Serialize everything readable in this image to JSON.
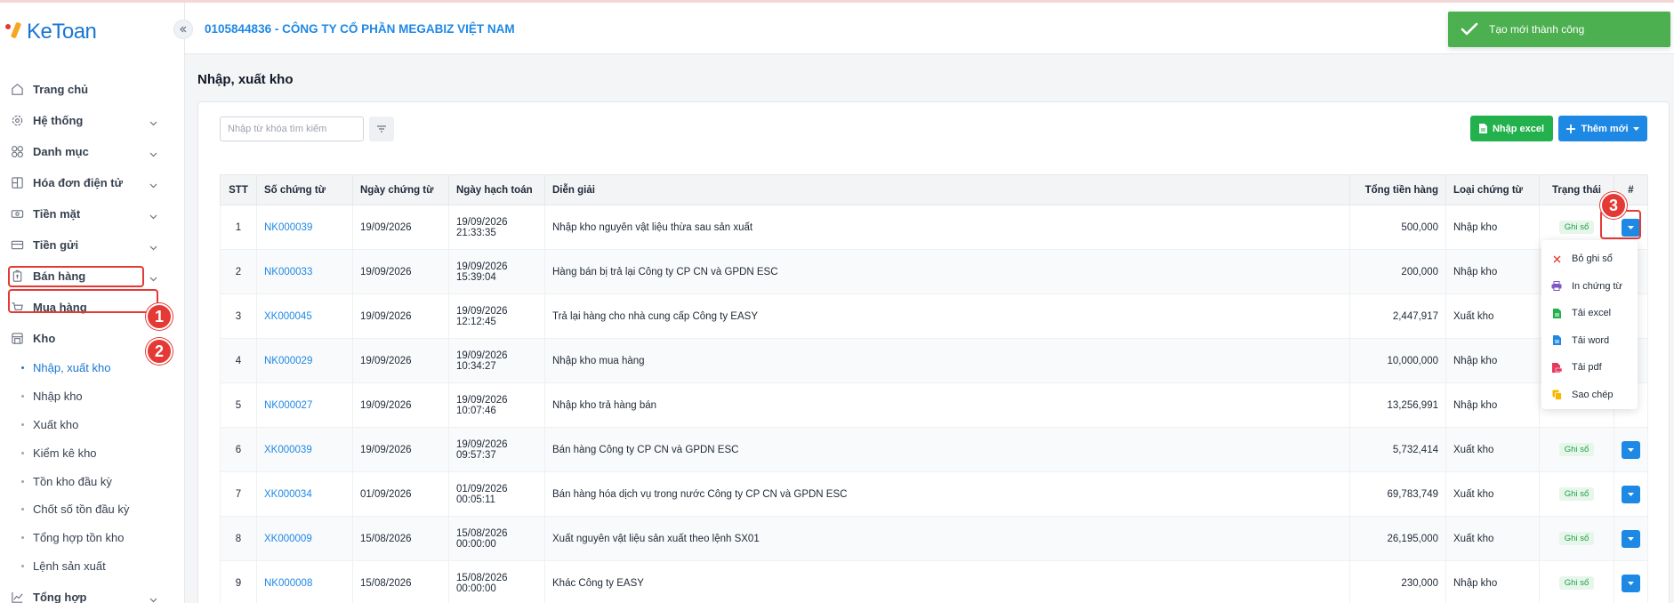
{
  "app": {
    "logo_text": "KeToan"
  },
  "header": {
    "company": "0105844836 - CÔNG TY CỔ PHẦN MEGABIZ VIỆT NAM"
  },
  "toast": {
    "message": "Tạo mới thành công"
  },
  "sidebar": {
    "items": [
      {
        "label": "Trang chủ",
        "icon": "home-icon",
        "chevron": false
      },
      {
        "label": "Hệ thống",
        "icon": "gear-icon",
        "chevron": true
      },
      {
        "label": "Danh mục",
        "icon": "grid-icon",
        "chevron": true
      },
      {
        "label": "Hóa đơn điện tử",
        "icon": "invoice-icon",
        "chevron": true
      },
      {
        "label": "Tiền mặt",
        "icon": "cash-icon",
        "chevron": true
      },
      {
        "label": "Tiền gửi",
        "icon": "bank-card-icon",
        "chevron": true
      },
      {
        "label": "Bán hàng",
        "icon": "sales-icon",
        "chevron": true
      },
      {
        "label": "Mua hàng",
        "icon": "cart-icon",
        "chevron": false
      },
      {
        "label": "Kho",
        "icon": "warehouse-icon",
        "chevron": false
      }
    ],
    "sub_items": [
      {
        "label": "Nhập, xuất kho",
        "active": true
      },
      {
        "label": "Nhập kho",
        "active": false
      },
      {
        "label": "Xuất kho",
        "active": false
      },
      {
        "label": "Kiểm kê kho",
        "active": false
      },
      {
        "label": "Tồn kho đầu kỳ",
        "active": false
      },
      {
        "label": "Chốt số tồn đầu kỳ",
        "active": false
      },
      {
        "label": "Tổng hợp tồn kho",
        "active": false
      },
      {
        "label": "Lệnh sản xuất",
        "active": false
      }
    ],
    "bottom_item": {
      "label": "Tổng hợp",
      "icon": "chart-line-icon"
    }
  },
  "callouts": [
    "1",
    "2",
    "3"
  ],
  "page": {
    "title": "Nhập, xuất kho"
  },
  "toolbar": {
    "search_placeholder": "Nhập từ khóa tìm kiếm",
    "import_excel": "Nhập excel",
    "add_new": "Thêm mới"
  },
  "table": {
    "headers": [
      "STT",
      "Số chứng từ",
      "Ngày chứng từ",
      "Ngày hạch toán",
      "Diễn giải",
      "Tổng tiền hàng",
      "Loại chứng từ",
      "Trạng thái",
      "#"
    ],
    "rows": [
      {
        "stt": "1",
        "code": "NK000039",
        "doc_date": "19/09/2026",
        "acc_date": "19/09/2026",
        "acc_time": "21:33:35",
        "desc": "Nhập kho nguyên vật liệu thừa sau sản xuất",
        "total": "500,000",
        "type": "Nhập kho",
        "status": "Ghi sổ"
      },
      {
        "stt": "2",
        "code": "NK000033",
        "doc_date": "19/09/2026",
        "acc_date": "19/09/2026",
        "acc_time": "15:39:04",
        "desc": "Hàng bán bị trả lại Công ty CP CN và GPDN ESC",
        "total": "200,000",
        "type": "Nhập kho",
        "status": ""
      },
      {
        "stt": "3",
        "code": "XK000045",
        "doc_date": "19/09/2026",
        "acc_date": "19/09/2026",
        "acc_time": "12:12:45",
        "desc": "Trả lại hàng cho nhà cung cấp Công ty EASY",
        "total": "2,447,917",
        "type": "Xuất kho",
        "status": ""
      },
      {
        "stt": "4",
        "code": "NK000029",
        "doc_date": "19/09/2026",
        "acc_date": "19/09/2026",
        "acc_time": "10:34:27",
        "desc": "Nhập kho mua hàng",
        "total": "10,000,000",
        "type": "Nhập kho",
        "status": ""
      },
      {
        "stt": "5",
        "code": "NK000027",
        "doc_date": "19/09/2026",
        "acc_date": "19/09/2026",
        "acc_time": "10:07:46",
        "desc": "Nhập kho trả hàng bán",
        "total": "13,256,991",
        "type": "Nhập kho",
        "status": ""
      },
      {
        "stt": "6",
        "code": "XK000039",
        "doc_date": "19/09/2026",
        "acc_date": "19/09/2026",
        "acc_time": "09:57:37",
        "desc": "Bán hàng Công ty CP CN và GPDN ESC",
        "total": "5,732,414",
        "type": "Xuất kho",
        "status": "Ghi sổ"
      },
      {
        "stt": "7",
        "code": "XK000034",
        "doc_date": "01/09/2026",
        "acc_date": "01/09/2026",
        "acc_time": "00:05:11",
        "desc": "Bán hàng hóa dịch vụ trong nước Công ty CP CN và GPDN ESC",
        "total": "69,783,749",
        "type": "Xuất kho",
        "status": "Ghi sổ"
      },
      {
        "stt": "8",
        "code": "XK000009",
        "doc_date": "15/08/2026",
        "acc_date": "15/08/2026",
        "acc_time": "00:00:00",
        "desc": "Xuất nguyên vật liệu sản xuất theo lệnh SX01",
        "total": "26,195,000",
        "type": "Xuất kho",
        "status": "Ghi sổ"
      },
      {
        "stt": "9",
        "code": "NK000008",
        "doc_date": "15/08/2026",
        "acc_date": "15/08/2026",
        "acc_time": "00:00:00",
        "desc": "Khác Công ty EASY",
        "total": "230,000",
        "type": "Nhập kho",
        "status": "Ghi sổ"
      }
    ]
  },
  "dropdown": {
    "items": [
      {
        "label": "Bỏ ghi sổ",
        "icon": "close-icon",
        "color": "#e53935"
      },
      {
        "label": "In chứng từ",
        "icon": "printer-icon",
        "color": "#7e57c2"
      },
      {
        "label": "Tải excel",
        "icon": "excel-file-icon",
        "color": "#22b14c"
      },
      {
        "label": "Tải word",
        "icon": "word-file-icon",
        "color": "#1e88e5"
      },
      {
        "label": "Tải pdf",
        "icon": "pdf-file-icon",
        "color": "#e53960"
      },
      {
        "label": "Sao chép",
        "icon": "copy-icon",
        "color": "#f5b800"
      }
    ]
  },
  "colors": {
    "primary": "#1e88e5",
    "success": "#22b14c",
    "callout": "#e53935"
  }
}
